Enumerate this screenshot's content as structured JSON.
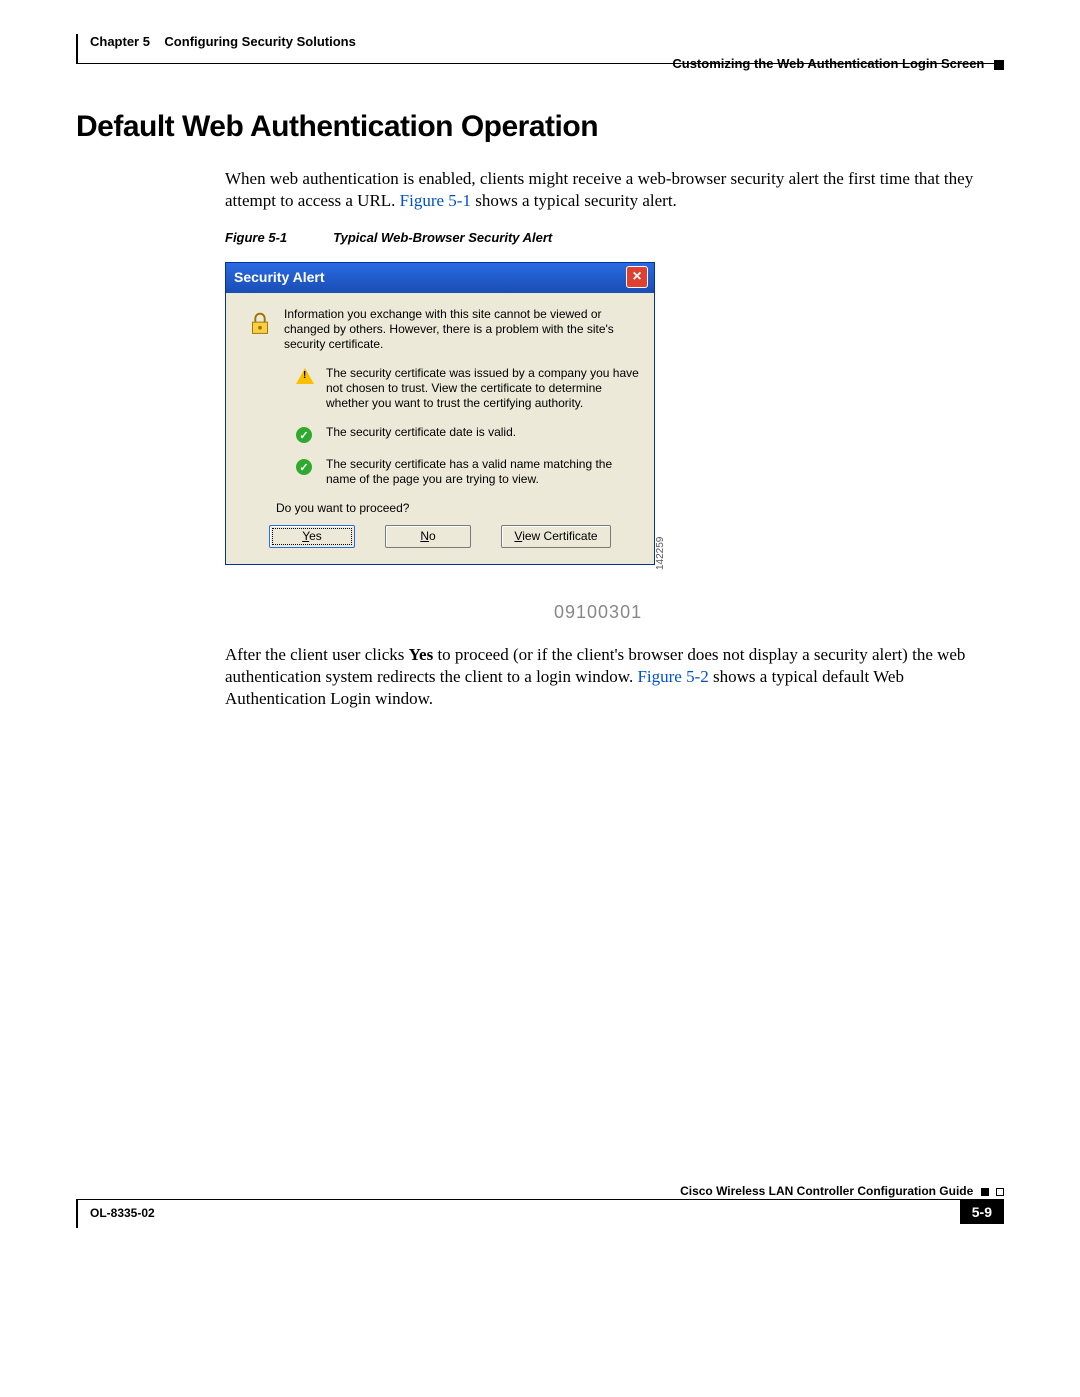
{
  "header": {
    "chapter_label": "Chapter 5",
    "chapter_title": "Configuring Security Solutions",
    "section": "Customizing the Web Authentication Login Screen"
  },
  "heading": "Default Web Authentication Operation",
  "paragraph1": {
    "pre": "When web authentication is enabled, clients might receive a web-browser security alert the first time that they attempt to access a URL. ",
    "link": "Figure 5-1",
    "post": " shows a typical security alert."
  },
  "figure1": {
    "label": "Figure 5-1",
    "caption": "Typical Web-Browser Security Alert"
  },
  "dialog": {
    "title": "Security Alert",
    "close": "×",
    "main_msg": "Information you exchange with this site cannot be viewed or changed by others. However, there is a problem with the site's security certificate.",
    "warn_msg": "The security certificate was issued by a company you have not chosen to trust. View the certificate to determine whether you want to trust the certifying authority.",
    "ok_msg1": "The security certificate date is valid.",
    "ok_msg2": "The security certificate has a valid name matching the name of the page you are trying to view.",
    "proceed": "Do you want to proceed?",
    "btn_yes_u": "Y",
    "btn_yes_rest": "es",
    "btn_no_u": "N",
    "btn_no_rest": "o",
    "btn_view_u": "V",
    "btn_view_rest": "iew Certificate",
    "watermark": "09100301",
    "sidecode": "142259"
  },
  "paragraph2": {
    "pre": "After the client user clicks ",
    "bold": "Yes",
    "mid": " to proceed (or if the client's browser does not display a security alert) the web authentication system redirects the client to a login window. ",
    "link": "Figure 5-2",
    "post": " shows a typical default Web Authentication Login window."
  },
  "footer": {
    "guide": "Cisco Wireless LAN Controller Configuration Guide",
    "doc_id": "OL-8335-02",
    "page": "5-9"
  }
}
